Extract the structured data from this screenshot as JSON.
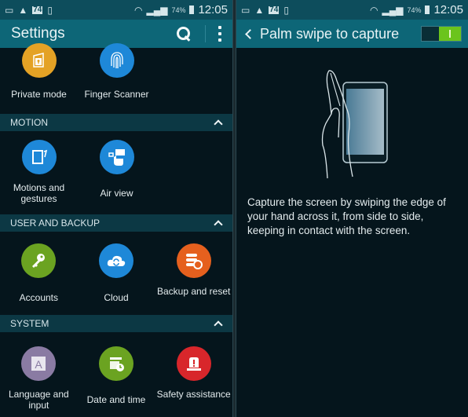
{
  "status_bar": {
    "notification_icons": [
      "gallery-icon",
      "warning-icon",
      "badge-74-icon",
      "no-sim-icon"
    ],
    "badge_text": "74",
    "battery_percent": "74%",
    "time": "12:05"
  },
  "left_screen": {
    "title": "Settings",
    "actions": [
      "search-icon",
      "more-options-icon"
    ],
    "top_items": [
      {
        "label": "Private mode",
        "icon": "lock-folder-icon",
        "color": "#e4a225"
      },
      {
        "label": "Finger Scanner",
        "icon": "fingerprint-icon",
        "color": "#1e88d8"
      }
    ],
    "sections": [
      {
        "header": "MOTION",
        "items": [
          {
            "label": "Motions and gestures",
            "icon": "tablet-motion-icon",
            "color": "#1e88d8"
          },
          {
            "label": "Air view",
            "icon": "hand-hover-icon",
            "color": "#1e88d8"
          }
        ]
      },
      {
        "header": "USER AND BACKUP",
        "items": [
          {
            "label": "Accounts",
            "icon": "key-icon",
            "color": "#6ba321"
          },
          {
            "label": "Cloud",
            "icon": "cloud-sync-icon",
            "color": "#1e88d8"
          },
          {
            "label": "Backup and reset",
            "icon": "database-restore-icon",
            "color": "#e5601e"
          }
        ]
      },
      {
        "header": "SYSTEM",
        "items": [
          {
            "label": "Language and input",
            "icon": "language-icon",
            "color": "#8a7ba3"
          },
          {
            "label": "Date and time",
            "icon": "calendar-clock-icon",
            "color": "#6ba321"
          },
          {
            "label": "Safety assistance",
            "icon": "emergency-light-icon",
            "color": "#d8262b"
          }
        ]
      }
    ]
  },
  "right_screen": {
    "title": "Palm swipe to capture",
    "toggle_state": "on",
    "description": "Capture the screen by swiping the edge of your hand across it, from side to side, keeping in contact with the screen."
  }
}
